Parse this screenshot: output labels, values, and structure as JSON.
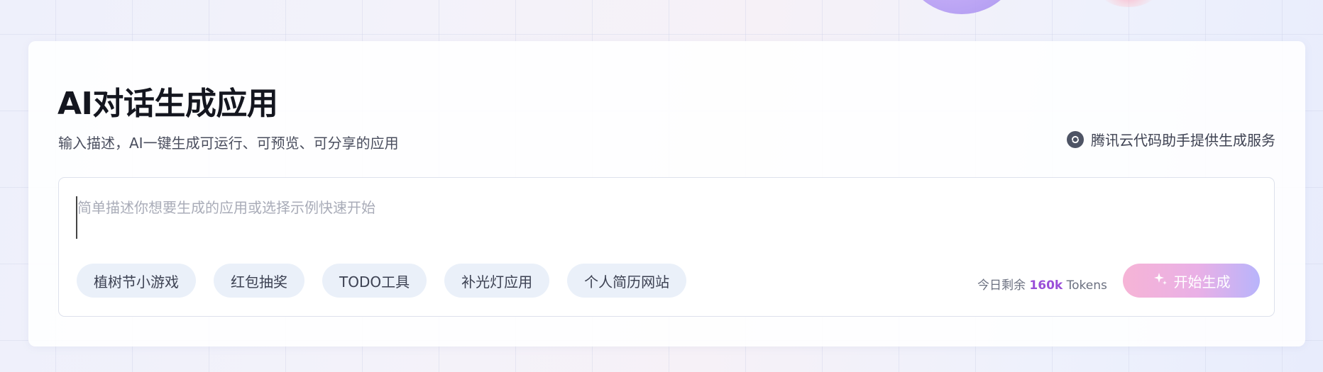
{
  "title": "AI对话生成应用",
  "subtitle": "输入描述，AI一键生成可运行、可预览、可分享的应用",
  "provider": {
    "icon": "tencent-code-assistant-icon",
    "label": "腾讯云代码助手提供生成服务"
  },
  "prompt": {
    "placeholder": "简单描述你想要生成的应用或选择示例快速开始",
    "value": ""
  },
  "examples": [
    {
      "label": "植树节小游戏"
    },
    {
      "label": "红包抽奖"
    },
    {
      "label": "TODO工具"
    },
    {
      "label": "补光灯应用"
    },
    {
      "label": "个人简历网站"
    }
  ],
  "tokens": {
    "prefix": "今日剩余",
    "amount": "160k",
    "unit": "Tokens"
  },
  "generate_button": {
    "icon": "sparkle-icon",
    "label": "开始生成"
  },
  "colors": {
    "accent_purple": "#9a4fd8",
    "button_gradient_start": "#f6b4d6",
    "button_gradient_end": "#b8b4fb",
    "chip_bg": "#eaf0f9"
  }
}
